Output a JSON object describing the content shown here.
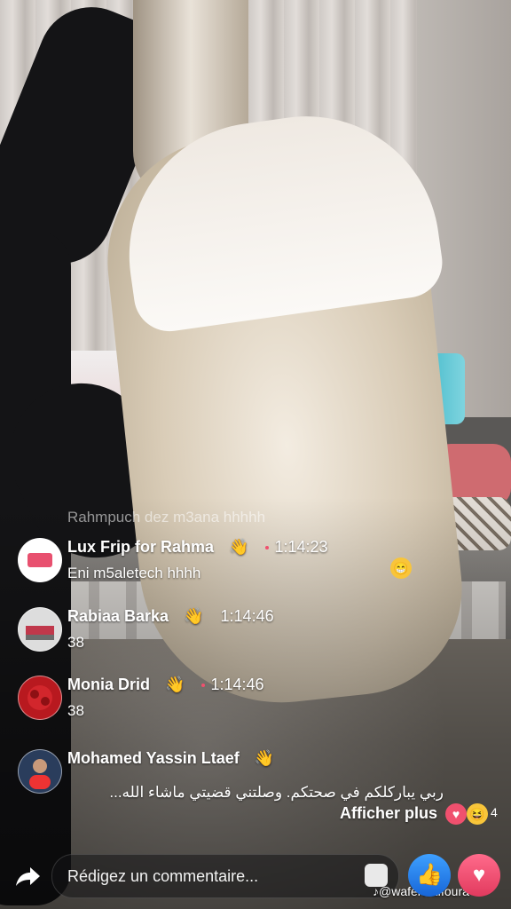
{
  "faded_comment": "Rahmpuch dez m3ana hhhhh",
  "comments": [
    {
      "name": "Lux Frip for Rahma",
      "time": "1:14:23",
      "text": "Eni m5aletech hhhh",
      "wave": "👋"
    },
    {
      "name": "Rabiaa Barka",
      "time": "1:14:46",
      "text": "38",
      "wave": "👋"
    },
    {
      "name": "Monia Drid",
      "time": "1:14:46",
      "text": "38",
      "wave": "👋"
    },
    {
      "name": "Mohamed Yassin Ltaef",
      "time": "",
      "text": "ربي يباركلكم في صحتكم. وصلتني قضيتي  ماشاء الله...",
      "wave": "👋"
    }
  ],
  "more_label": "Afficher plus",
  "reactions": {
    "heart": "♥",
    "haha": "😆",
    "count": "4",
    "face": "😁"
  },
  "composer": {
    "placeholder": "Rédigez un commentaire..."
  },
  "watermark": "♪@waferwaffoura",
  "buttons": {
    "like": "👍",
    "love": "♥",
    "share": "➦"
  },
  "colors": {
    "like": "#1877f2",
    "love": "#f0506e",
    "live_dot": "#f0506e"
  }
}
